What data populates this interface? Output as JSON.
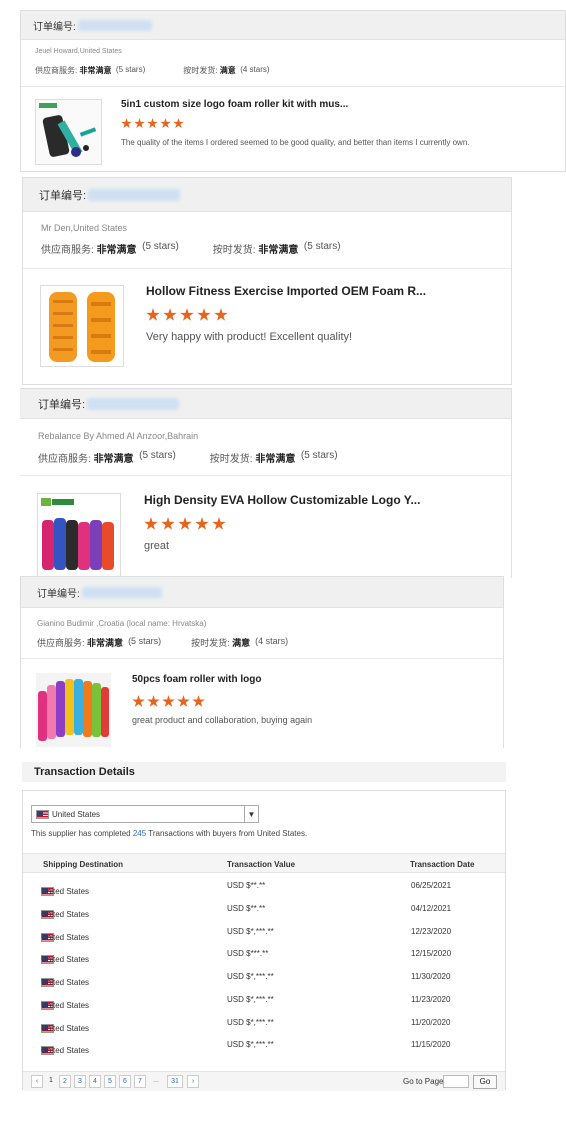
{
  "reviews": [
    {
      "order_label": "订单编号:",
      "buyer": "Jeuel Howard,United States",
      "supplier_service_label": "供应商服务:",
      "supplier_service_value": "非常满意",
      "supplier_service_stars": "(5 stars)",
      "ontime_label": "按时发货:",
      "ontime_value": "满意",
      "ontime_stars": "(4 stars)",
      "product_title": "5in1 custom size logo foam roller kit with mus...",
      "rating": 5,
      "review": "The quality of the items I ordered seemed to be good quality, and better than items I currently own."
    },
    {
      "order_label": "订单编号:",
      "buyer": "Mr Den,United States",
      "supplier_service_label": "供应商服务:",
      "supplier_service_value": "非常满意",
      "supplier_service_stars": "(5 stars)",
      "ontime_label": "按时发货:",
      "ontime_value": "非常满意",
      "ontime_stars": "(5 stars)",
      "product_title": "Hollow Fitness Exercise Imported OEM Foam R...",
      "rating": 5,
      "review": "Very happy with product! Excellent quality!"
    },
    {
      "order_label": "订单编号:",
      "buyer": "Rebalance By Ahmed Al Anzoor,Bahrain",
      "supplier_service_label": "供应商服务:",
      "supplier_service_value": "非常满意",
      "supplier_service_stars": "(5 stars)",
      "ontime_label": "按时发货:",
      "ontime_value": "非常满意",
      "ontime_stars": "(5 stars)",
      "product_title": "High Density EVA Hollow Customizable Logo Y...",
      "rating": 5,
      "review": "great"
    },
    {
      "order_label": "订单编号:",
      "buyer": "Gianino Budimir ,Croatia (local name: Hrvatska)",
      "supplier_service_label": "供应商服务:",
      "supplier_service_value": "非常满意",
      "supplier_service_stars": "(5 stars)",
      "ontime_label": "按时发货:",
      "ontime_value": "满意",
      "ontime_stars": "(4 stars)",
      "product_title": "50pcs foam roller with logo",
      "rating": 5,
      "review": "great product and collaboration, buying again"
    }
  ],
  "transactions": {
    "title": "Transaction Details",
    "country_select": "United States",
    "summary_prefix": "This supplier has completed",
    "summary_count": "245",
    "summary_suffix": "Transactions with buyers from United States.",
    "headers": [
      "Shipping Destination",
      "Transaction Value",
      "Transaction Date"
    ],
    "rows": [
      {
        "dest": "United States",
        "value": "USD $**.**",
        "date": "06/25/2021"
      },
      {
        "dest": "United States",
        "value": "USD $**.**",
        "date": "04/12/2021"
      },
      {
        "dest": "United States",
        "value": "USD $*,***.**",
        "date": "12/23/2020"
      },
      {
        "dest": "United States",
        "value": "USD $***.**",
        "date": "12/15/2020"
      },
      {
        "dest": "United States",
        "value": "USD $*,***.**",
        "date": "11/30/2020"
      },
      {
        "dest": "United States",
        "value": "USD $*,***.**",
        "date": "11/23/2020"
      },
      {
        "dest": "United States",
        "value": "USD $*,***.**",
        "date": "11/20/2020"
      },
      {
        "dest": "United States",
        "value": "USD $*,***.**",
        "date": "11/15/2020"
      }
    ],
    "pagination": {
      "prev": "‹",
      "pages": [
        "1",
        "2",
        "3",
        "4",
        "5",
        "6",
        "7"
      ],
      "ellipsis": "...",
      "last": "31",
      "next": "›",
      "goto_label": "Go to Page",
      "go_button": "Go"
    }
  },
  "colors": {
    "star": "#e8641b",
    "link": "#2a6bb8",
    "header_bg": "#f0f0f0"
  }
}
